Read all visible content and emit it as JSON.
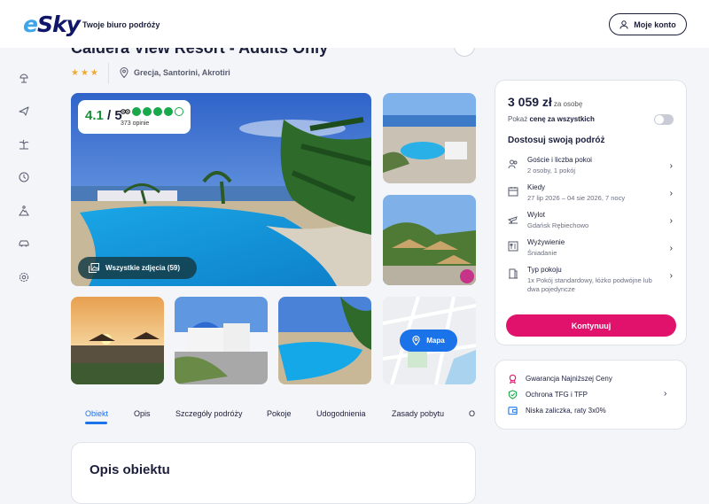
{
  "header": {
    "logo_prefix": "e",
    "logo_rest": "Sky",
    "tagline": "Twoje biuro podróży",
    "account_label": "Moje konto"
  },
  "sidebar": {
    "items": [
      {
        "icon": "beach-umbrella-icon"
      },
      {
        "icon": "plane-icon"
      },
      {
        "icon": "palm-tree-icon"
      },
      {
        "icon": "clock-icon"
      },
      {
        "icon": "mountain-person-icon"
      },
      {
        "icon": "car-icon"
      },
      {
        "icon": "settings-icon"
      }
    ]
  },
  "hotel": {
    "title": "Caldera View Resort - Adults Only",
    "stars": "★★★",
    "location": "Grecja, Santorini, Akrotiri"
  },
  "rating": {
    "score": "4.1",
    "max": "/ 5",
    "dots_filled": 4,
    "dots_total": 5,
    "reviews": "373 opinie"
  },
  "gallery": {
    "all_photos_label": "Wszystkie zdjęcia (59)",
    "map_label": "Mapa"
  },
  "tabs": [
    {
      "label": "Obiekt",
      "active": true
    },
    {
      "label": "Opis"
    },
    {
      "label": "Szczegóły podróży"
    },
    {
      "label": "Pokoje"
    },
    {
      "label": "Udogodnienia"
    },
    {
      "label": "Zasady pobytu"
    },
    {
      "label": "Op"
    }
  ],
  "description": {
    "heading": "Opis obiektu"
  },
  "booking": {
    "price": "3 059 zł",
    "price_unit": "za osobę",
    "toggle_prefix": "Pokaż",
    "toggle_bold": "cenę za wszystkich",
    "customize_title": "Dostosuj swoją podróż",
    "options": [
      {
        "icon": "guests-icon",
        "label": "Goście i liczba pokoi",
        "value": "2 osoby, 1 pokój"
      },
      {
        "icon": "calendar-icon",
        "label": "Kiedy",
        "value": "27 lip 2026 – 04 sie 2026, 7 nocy"
      },
      {
        "icon": "departure-icon",
        "label": "Wylot",
        "value": "Gdańsk Rębiechowo"
      },
      {
        "icon": "meal-icon",
        "label": "Wyżywienie",
        "value": "Śniadanie"
      },
      {
        "icon": "room-door-icon",
        "label": "Typ pokoju",
        "value": "1x Pokój standardowy, łóżko podwójne lub dwa pojedyncze"
      }
    ],
    "continue_label": "Kontynuuj"
  },
  "guarantees": {
    "items": [
      {
        "icon": "award-icon",
        "label": "Gwarancja Najniższej Ceny",
        "color": "#e0126b"
      },
      {
        "icon": "shield-check-icon",
        "label": "Ochrona TFG i TFP",
        "color": "#19a84a"
      },
      {
        "icon": "wallet-icon",
        "label": "Niska zaliczka, raty 3x0%",
        "color": "#1a73e8"
      }
    ]
  },
  "colors": {
    "brand_navy": "#10166a",
    "accent_pink": "#e0126b",
    "link_blue": "#1a73e8",
    "rating_green": "#19a84a",
    "star_gold": "#f0a830"
  }
}
